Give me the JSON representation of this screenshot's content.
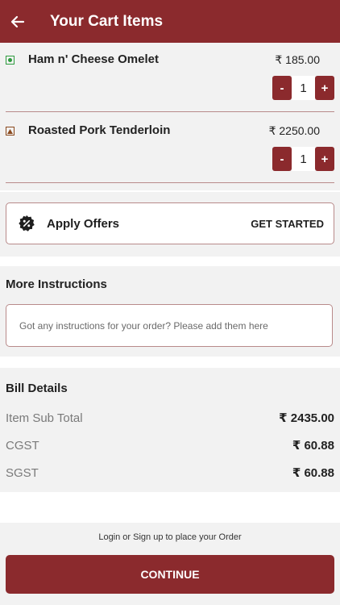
{
  "header": {
    "title": "Your Cart Items"
  },
  "cart": {
    "items": [
      {
        "name": "Ham n' Cheese Omelet",
        "price": "₹ 185.00",
        "qty": "1",
        "type": "veg"
      },
      {
        "name": "Roasted Pork Tenderloin",
        "price": "₹ 2250.00",
        "qty": "1",
        "type": "non-veg"
      }
    ],
    "minus_label": "-",
    "plus_label": "+"
  },
  "offers": {
    "label": "Apply Offers",
    "cta": "GET STARTED"
  },
  "instructions": {
    "title": "More Instructions",
    "placeholder": "Got any instructions for your order? Please add them here"
  },
  "bill": {
    "title": "Bill Details",
    "rows": [
      {
        "label": "Item Sub Total",
        "value": "₹ 2435.00"
      },
      {
        "label": "CGST",
        "value": "₹ 60.88"
      },
      {
        "label": "SGST",
        "value": "₹ 60.88"
      }
    ]
  },
  "footer": {
    "login_text": "Login or Sign up to place your Order",
    "continue_label": "CONTINUE"
  },
  "colors": {
    "accent": "#8b2a2d",
    "panel": "#f2f2f2",
    "veg": "#2e9b3f",
    "nonveg": "#8b4a1e"
  },
  "icons": {
    "back": "arrow-left-icon",
    "offer": "discount-badge-icon"
  }
}
